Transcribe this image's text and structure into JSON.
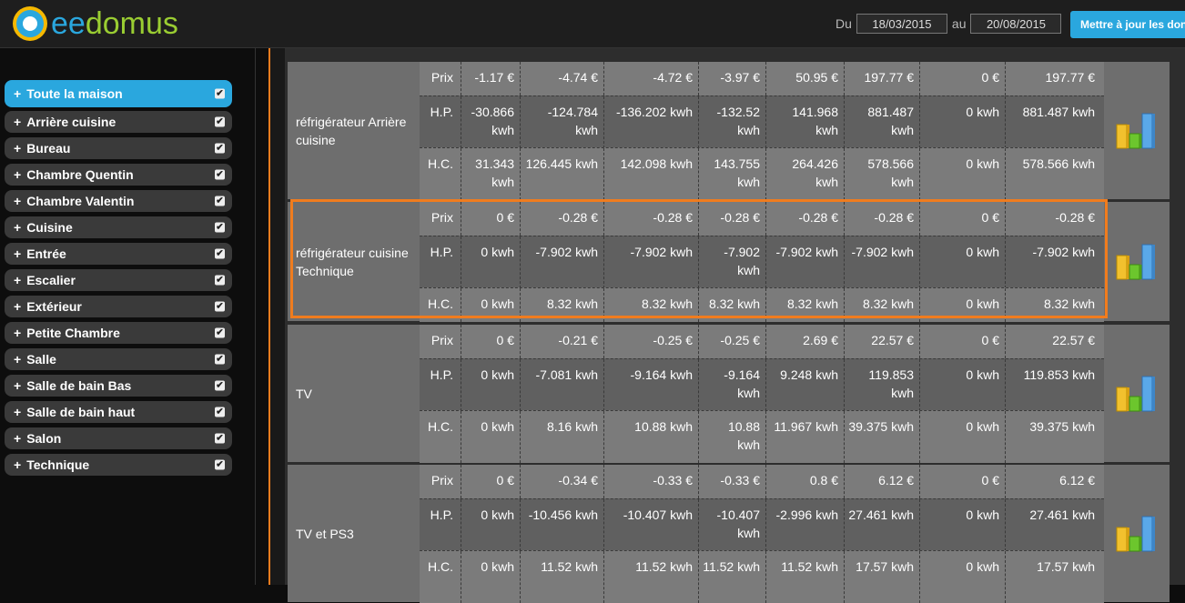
{
  "header": {
    "logo_prefix": "ee",
    "logo_suffix": "domus",
    "from_label": "Du",
    "from_date": "18/03/2015",
    "to_label": "au",
    "to_date": "20/08/2015",
    "update_button": "Mettre à jour les donn"
  },
  "sidebar": {
    "items": [
      {
        "label": "Toute la maison"
      },
      {
        "label": "Arrière cuisine"
      },
      {
        "label": "Bureau"
      },
      {
        "label": "Chambre Quentin"
      },
      {
        "label": "Chambre Valentin"
      },
      {
        "label": "Cuisine"
      },
      {
        "label": "Entrée"
      },
      {
        "label": "Escalier"
      },
      {
        "label": "Extérieur"
      },
      {
        "label": "Petite Chambre"
      },
      {
        "label": "Salle"
      },
      {
        "label": "Salle de bain Bas"
      },
      {
        "label": "Salle de bain haut"
      },
      {
        "label": "Salon"
      },
      {
        "label": "Technique"
      }
    ]
  },
  "row_labels": [
    "Prix",
    "H.P.",
    "H.C."
  ],
  "devices": [
    {
      "name": "réfrigérateur Arrière cuisine",
      "prix": [
        "-1.17 €",
        "-4.74 €",
        "-4.72 €",
        "-3.97 €",
        "50.95 €",
        "197.77 €",
        "0 €",
        "197.77 €"
      ],
      "hp": [
        "-30.866 kwh",
        "-124.784 kwh",
        "-136.202 kwh",
        "-132.52 kwh",
        "141.968 kwh",
        "881.487 kwh",
        "0 kwh",
        "881.487 kwh"
      ],
      "hc": [
        "31.343 kwh",
        "126.445 kwh",
        "142.098 kwh",
        "143.755 kwh",
        "264.426 kwh",
        "578.566 kwh",
        "0 kwh",
        "578.566 kwh"
      ]
    },
    {
      "name": "réfrigérateur cuisine Technique",
      "prix": [
        "0 €",
        "-0.28 €",
        "-0.28 €",
        "-0.28 €",
        "-0.28 €",
        "-0.28 €",
        "0 €",
        "-0.28 €"
      ],
      "hp": [
        "0 kwh",
        "-7.902 kwh",
        "-7.902 kwh",
        "-7.902 kwh",
        "-7.902 kwh",
        "-7.902 kwh",
        "0 kwh",
        "-7.902 kwh"
      ],
      "hc": [
        "0 kwh",
        "8.32 kwh",
        "8.32 kwh",
        "8.32 kwh",
        "8.32 kwh",
        "8.32 kwh",
        "0 kwh",
        "8.32 kwh"
      ]
    },
    {
      "name": "TV",
      "prix": [
        "0 €",
        "-0.21 €",
        "-0.25 €",
        "-0.25 €",
        "2.69 €",
        "22.57 €",
        "0 €",
        "22.57 €"
      ],
      "hp": [
        "0 kwh",
        "-7.081 kwh",
        "-9.164 kwh",
        "-9.164 kwh",
        "9.248 kwh",
        "119.853 kwh",
        "0 kwh",
        "119.853 kwh"
      ],
      "hc": [
        "0 kwh",
        "8.16 kwh",
        "10.88 kwh",
        "10.88 kwh",
        "11.967 kwh",
        "39.375 kwh",
        "0 kwh",
        "39.375 kwh"
      ]
    },
    {
      "name": "TV et PS3",
      "prix": [
        "0 €",
        "-0.34 €",
        "-0.33 €",
        "-0.33 €",
        "0.8 €",
        "6.12 €",
        "0 €",
        "6.12 €"
      ],
      "hp": [
        "0 kwh",
        "-10.456 kwh",
        "-10.407 kwh",
        "-10.407 kwh",
        "-2.996 kwh",
        "27.461 kwh",
        "0 kwh",
        "27.461 kwh"
      ],
      "hc": [
        "0 kwh",
        "11.52 kwh",
        "11.52 kwh",
        "11.52 kwh",
        "11.52 kwh",
        "17.57 kwh",
        "0 kwh",
        "17.57 kwh"
      ]
    }
  ],
  "colors": {
    "accent_blue": "#2aa7de",
    "highlight_orange": "#f07c1e",
    "logo_green": "#9acd32"
  }
}
